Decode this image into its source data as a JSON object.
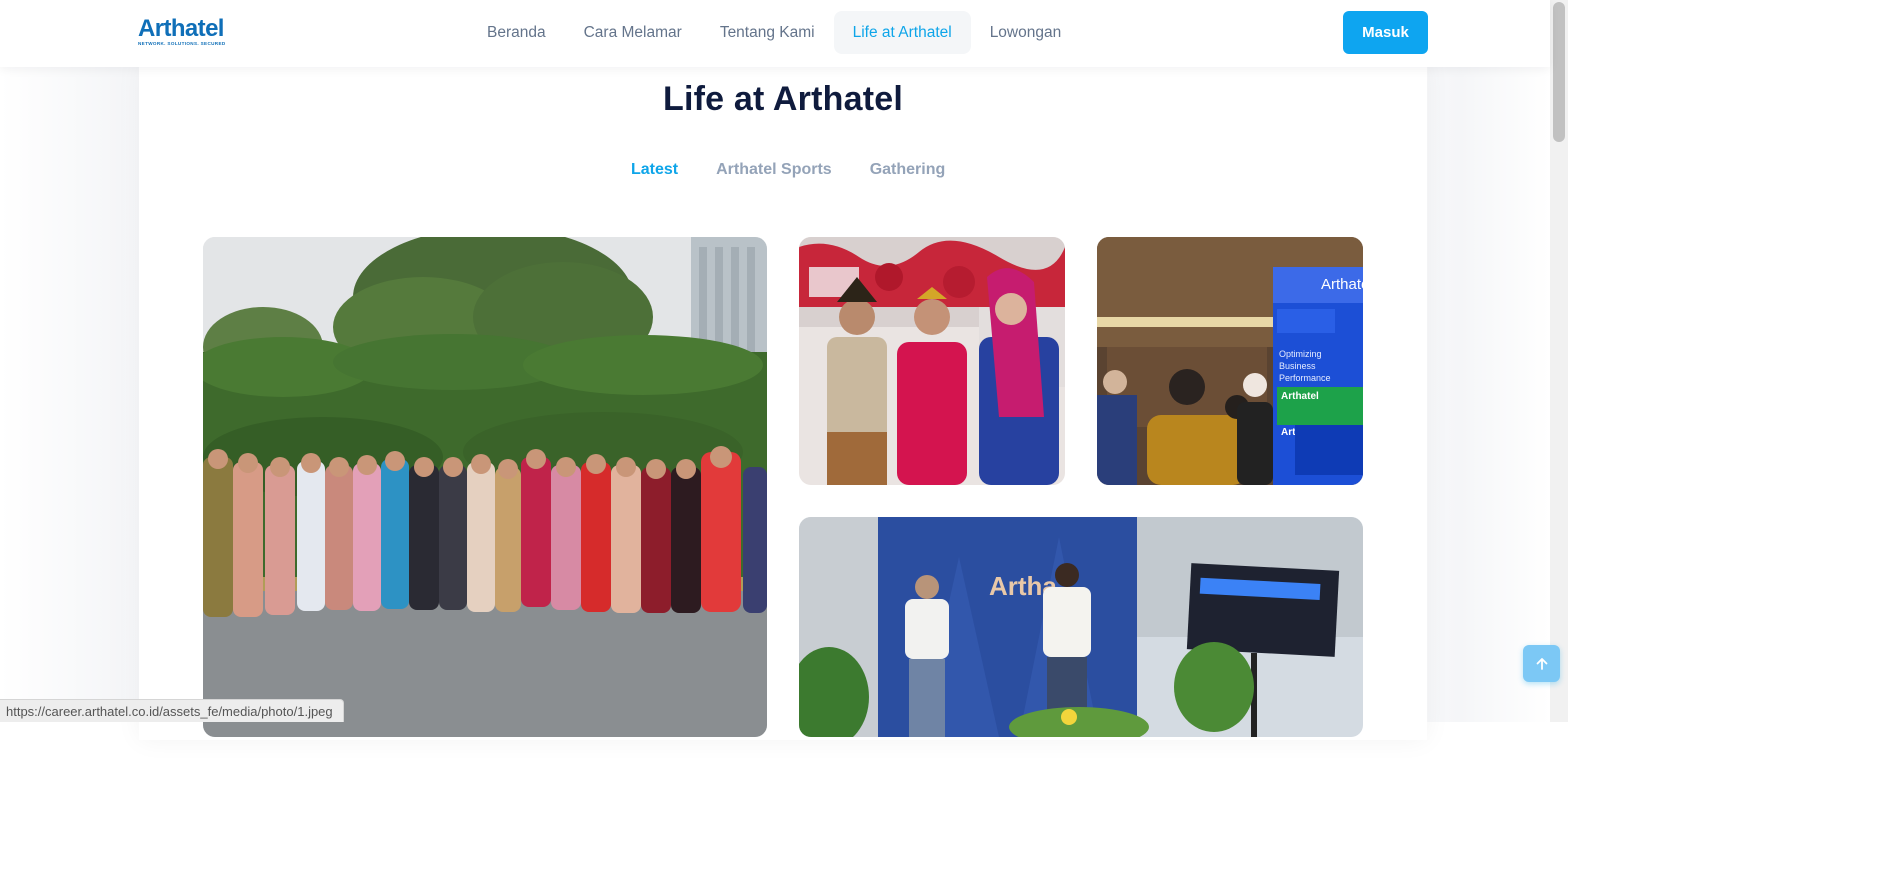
{
  "header": {
    "logo": {
      "name": "Arthatel",
      "tagline": "NETWORK. SOLUTIONS. SECURED"
    },
    "nav": [
      {
        "label": "Beranda",
        "active": false
      },
      {
        "label": "Cara Melamar",
        "active": false
      },
      {
        "label": "Tentang Kami",
        "active": false
      },
      {
        "label": "Life at Arthatel",
        "active": true
      },
      {
        "label": "Lowongan",
        "active": false
      }
    ],
    "login_label": "Masuk"
  },
  "main": {
    "title": "Life at Arthatel",
    "tabs": [
      {
        "label": "Latest",
        "active": true
      },
      {
        "label": "Arthatel Sports",
        "active": false
      },
      {
        "label": "Gathering",
        "active": false
      }
    ],
    "gallery": [
      {
        "subject": "group-photo-traditional-dress"
      },
      {
        "subject": "traditional-costume-performers"
      },
      {
        "subject": "exhibition-booth"
      },
      {
        "subject": "stage-event-speakers"
      }
    ],
    "booth_texts": {
      "brand": "Arthatel",
      "line1": "Optimizing",
      "line2": "Business",
      "line3": "Performance",
      "badge": "Arthatel",
      "badge2": "Arthatel"
    },
    "stage_logo": "Artha"
  },
  "back_to_top_icon": "arrow-up-icon",
  "status_bar": {
    "url": "https://career.arthatel.co.id/assets_fe/media/photo/1.jpeg"
  },
  "colors": {
    "accent": "#0ea5e9",
    "title": "#0f1b3d",
    "logo": "#0f6fb8",
    "nav_text": "#64748b"
  }
}
